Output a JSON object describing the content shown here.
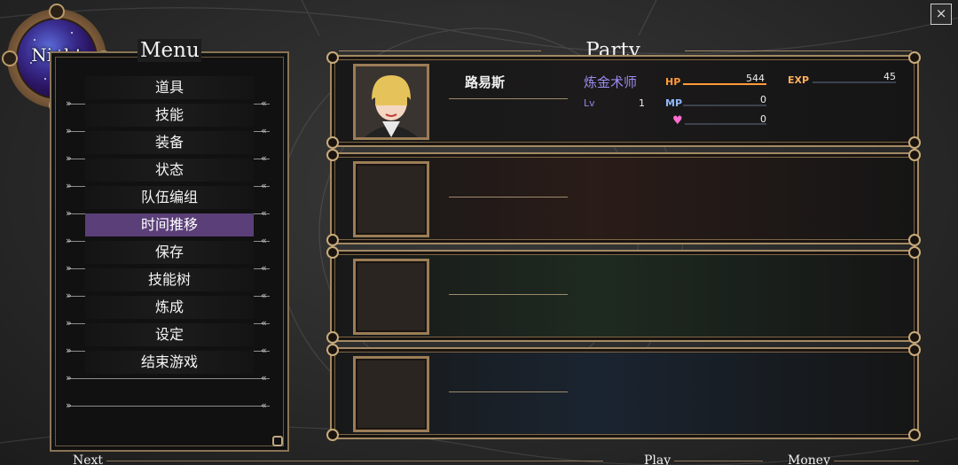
{
  "header": {
    "close_label": "×",
    "close_icon": "close-icon"
  },
  "emblem": {
    "label": "Night",
    "icon": "night-sky-emblem"
  },
  "menu": {
    "title": "Menu",
    "items": [
      {
        "label": "道具",
        "selected": false
      },
      {
        "label": "技能",
        "selected": false
      },
      {
        "label": "装备",
        "selected": false
      },
      {
        "label": "状态",
        "selected": false
      },
      {
        "label": "队伍编组",
        "selected": false
      },
      {
        "label": "时间推移",
        "selected": true
      },
      {
        "label": "保存",
        "selected": false
      },
      {
        "label": "技能树",
        "selected": false
      },
      {
        "label": "炼成",
        "selected": false
      },
      {
        "label": "设定",
        "selected": false
      },
      {
        "label": "结束游戏",
        "selected": false
      }
    ]
  },
  "party": {
    "title": "Party member",
    "members": [
      {
        "name": "路易斯",
        "class": "炼金术师",
        "lv_label": "Lv",
        "lv": "1",
        "hp_label": "HP",
        "hp": "544",
        "hp_fill": 1.0,
        "mp_label": "MP",
        "mp": "0",
        "mp_fill": 0.0,
        "heart": "0",
        "heart_fill": 0.0,
        "exp_label": "EXP",
        "exp": "45",
        "exp_fill": 0.0
      }
    ],
    "slot_backgrounds": [
      "#1c1a1a",
      "#2a1c18",
      "#1e2a20",
      "#1a2430"
    ]
  },
  "bottom": {
    "next": "Next",
    "play": "Play",
    "money": "Money"
  },
  "colors": {
    "accent_frame": "#a38a64",
    "selected_menu": "#5b3f78",
    "hp_label": "#ff9a3a",
    "mp_label": "#8fb8ff",
    "exp_label": "#ffb060",
    "heart": "#ff6ed0",
    "class_text": "#9a8cf0"
  }
}
